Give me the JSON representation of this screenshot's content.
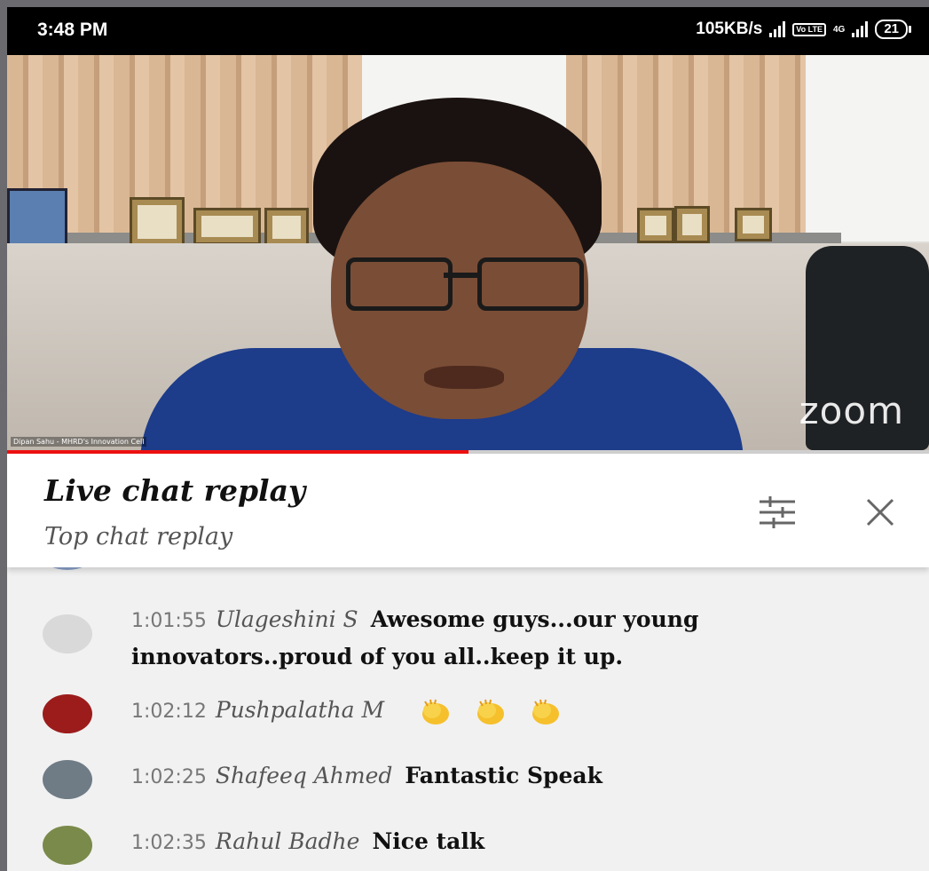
{
  "status_bar": {
    "time": "3:48 PM",
    "speed": "105KB/s",
    "volte": "Vo LTE",
    "network": "4G",
    "battery": "21"
  },
  "video": {
    "watermark": "zoom",
    "caption": "Dipan Sahu - MHRD's Innovation Cell",
    "progress_percent": 50
  },
  "chat_header": {
    "title": "Live chat replay",
    "subtitle": "Top chat replay",
    "filter_icon": "tune-icon",
    "close_icon": "close-icon"
  },
  "messages": [
    {
      "time": "1:01:55",
      "author": "Ulageshini S",
      "text": "Awesome guys...our young innovators..proud of you all..keep it up.",
      "avatar_color": "#d9d9d9"
    },
    {
      "time": "1:02:12",
      "author": "Pushpalatha M",
      "text": "",
      "emoji": "clapping-hands-icon",
      "emoji_count": 3,
      "avatar_color": "#9c1c1c"
    },
    {
      "time": "1:02:25",
      "author": "Shafeeq Ahmed",
      "text": "Fantastic Speak",
      "avatar_color": "#6f7c86"
    },
    {
      "time": "1:02:35",
      "author": "Rahul Badhe",
      "text": "Nice talk",
      "avatar_color": "#7a8a4a"
    }
  ]
}
